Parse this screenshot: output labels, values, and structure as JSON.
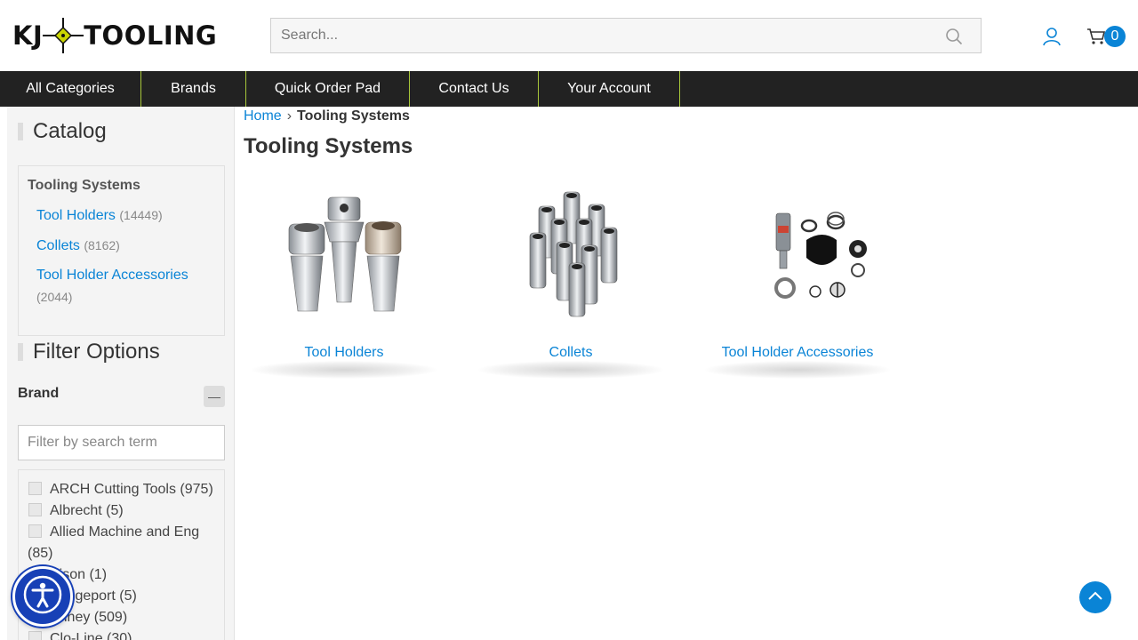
{
  "header": {
    "logo_left": "KJ",
    "logo_right": "TOOLING",
    "search_placeholder": "Search...",
    "cart_count": "0",
    "icons": [
      "search-icon",
      "user-icon",
      "cart-icon"
    ],
    "accent_color": "#0a84d6"
  },
  "nav": {
    "items": [
      "All Categories",
      "Brands",
      "Quick Order Pad",
      "Contact Us",
      "Your Account"
    ],
    "background": "#222222",
    "divider_color": "#a8c73a"
  },
  "sidebar": {
    "catalog_heading": "Catalog",
    "category_title": "Tooling Systems",
    "categories": [
      {
        "label": "Tool Holders",
        "count": "(14449)"
      },
      {
        "label": "Collets",
        "count": "(8162)"
      },
      {
        "label": "Tool Holder Accessories",
        "count": "(2044)"
      }
    ],
    "filter_heading": "Filter Options",
    "brand_label": "Brand",
    "collapse_symbol": "—",
    "filter_placeholder": "Filter by search term",
    "brands": [
      "ARCH Cutting Tools (975)",
      "Albrecht (5)",
      "Allied Machine and Eng (85)",
      "Bison (1)",
      "Bridgeport (5)",
      "Briney (509)",
      "Clo-Line (30)"
    ]
  },
  "main": {
    "breadcrumb_home": "Home",
    "breadcrumb_sep": "›",
    "breadcrumb_current": "Tooling Systems",
    "title": "Tooling Systems",
    "tiles": [
      "Tool Holders",
      "Collets",
      "Tool Holder Accessories"
    ]
  },
  "floating": {
    "icons": [
      "accessibility-icon",
      "arrow-up-icon"
    ]
  }
}
